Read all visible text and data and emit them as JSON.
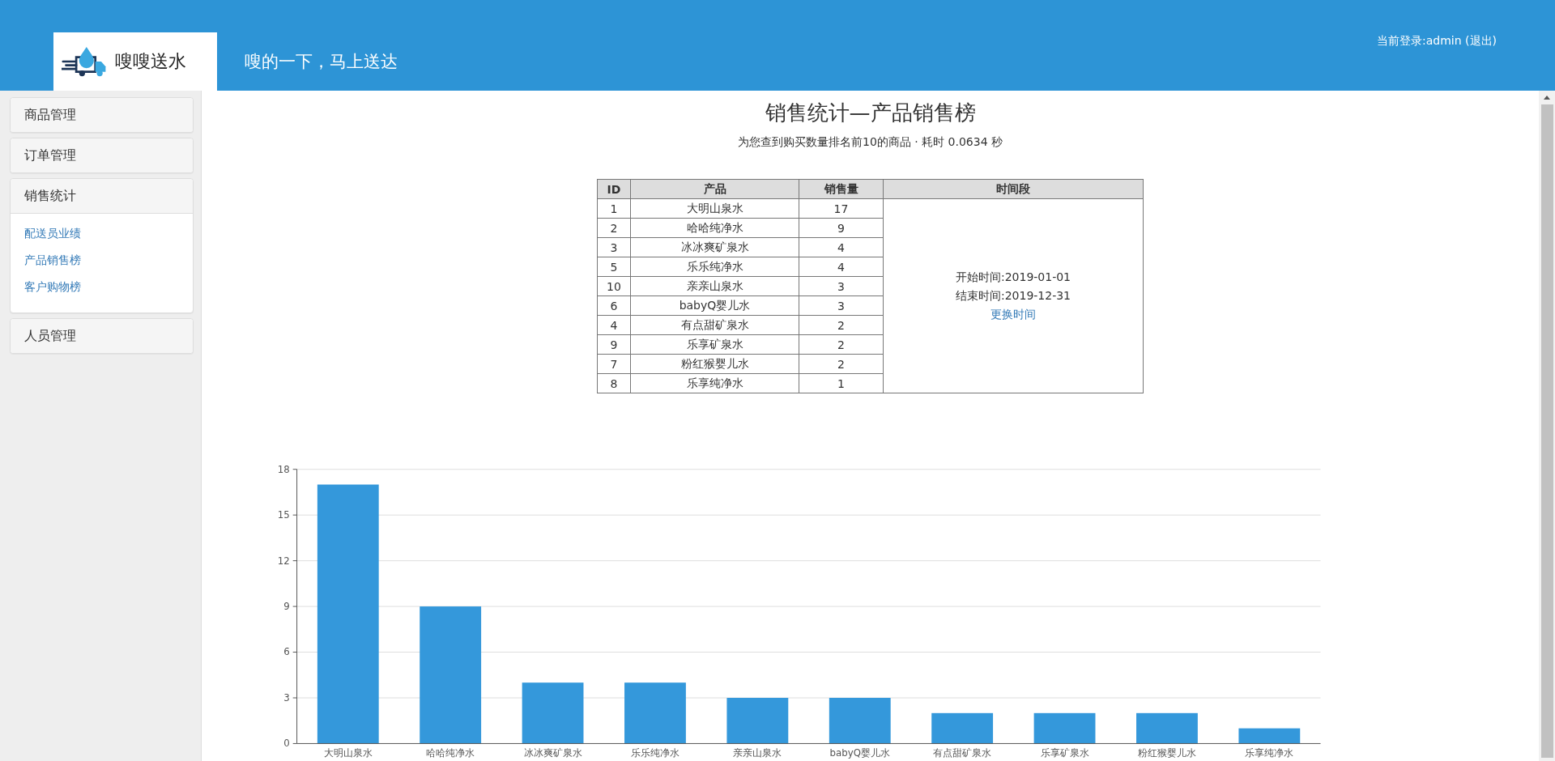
{
  "header": {
    "logo_text": "嗖嗖送水",
    "slogan": "嗖的一下，马上送达",
    "login_text": "当前登录:admin (退出)"
  },
  "sidebar": {
    "groups": [
      {
        "label": "商品管理",
        "expanded": false
      },
      {
        "label": "订单管理",
        "expanded": false
      },
      {
        "label": "销售统计",
        "expanded": true,
        "children": [
          {
            "label": "配送员业绩"
          },
          {
            "label": "产品销售榜"
          },
          {
            "label": "客户购物榜"
          }
        ]
      },
      {
        "label": "人员管理",
        "expanded": false
      }
    ]
  },
  "content": {
    "title": "销售统计—产品销售榜",
    "subtitle": "为您查到购买数量排名前10的商品 · 耗时 0.0634 秒",
    "table": {
      "columns": [
        "ID",
        "产品",
        "销售量",
        "时间段"
      ],
      "rows": [
        {
          "id": "1",
          "product": "大明山泉水",
          "sales": "17"
        },
        {
          "id": "2",
          "product": "哈哈纯净水",
          "sales": "9"
        },
        {
          "id": "3",
          "product": "冰冰爽矿泉水",
          "sales": "4"
        },
        {
          "id": "5",
          "product": "乐乐纯净水",
          "sales": "4"
        },
        {
          "id": "10",
          "product": "亲亲山泉水",
          "sales": "3"
        },
        {
          "id": "6",
          "product": "babyQ婴儿水",
          "sales": "3"
        },
        {
          "id": "4",
          "product": "有点甜矿泉水",
          "sales": "2"
        },
        {
          "id": "9",
          "product": "乐享矿泉水",
          "sales": "2"
        },
        {
          "id": "7",
          "product": "粉红猴婴儿水",
          "sales": "2"
        },
        {
          "id": "8",
          "product": "乐享纯净水",
          "sales": "1"
        }
      ],
      "period": {
        "start": "开始时间:2019-01-01",
        "end": "结束时间:2019-12-31",
        "link": "更换时间"
      }
    },
    "chart_data": {
      "type": "bar",
      "categories": [
        "大明山泉水",
        "哈哈纯净水",
        "冰冰爽矿泉水",
        "乐乐纯净水",
        "亲亲山泉水",
        "babyQ婴儿水",
        "有点甜矿泉水",
        "乐享矿泉水",
        "粉红猴婴儿水",
        "乐享纯净水"
      ],
      "grid": true,
      "series": [
        {
          "color": "#3498db",
          "values": [
            17,
            9,
            4,
            4,
            3,
            3,
            2,
            2,
            2,
            1
          ]
        }
      ],
      "ylim": [
        0,
        18
      ],
      "yticks": [
        0,
        3,
        6,
        9,
        12,
        15,
        18
      ]
    }
  }
}
